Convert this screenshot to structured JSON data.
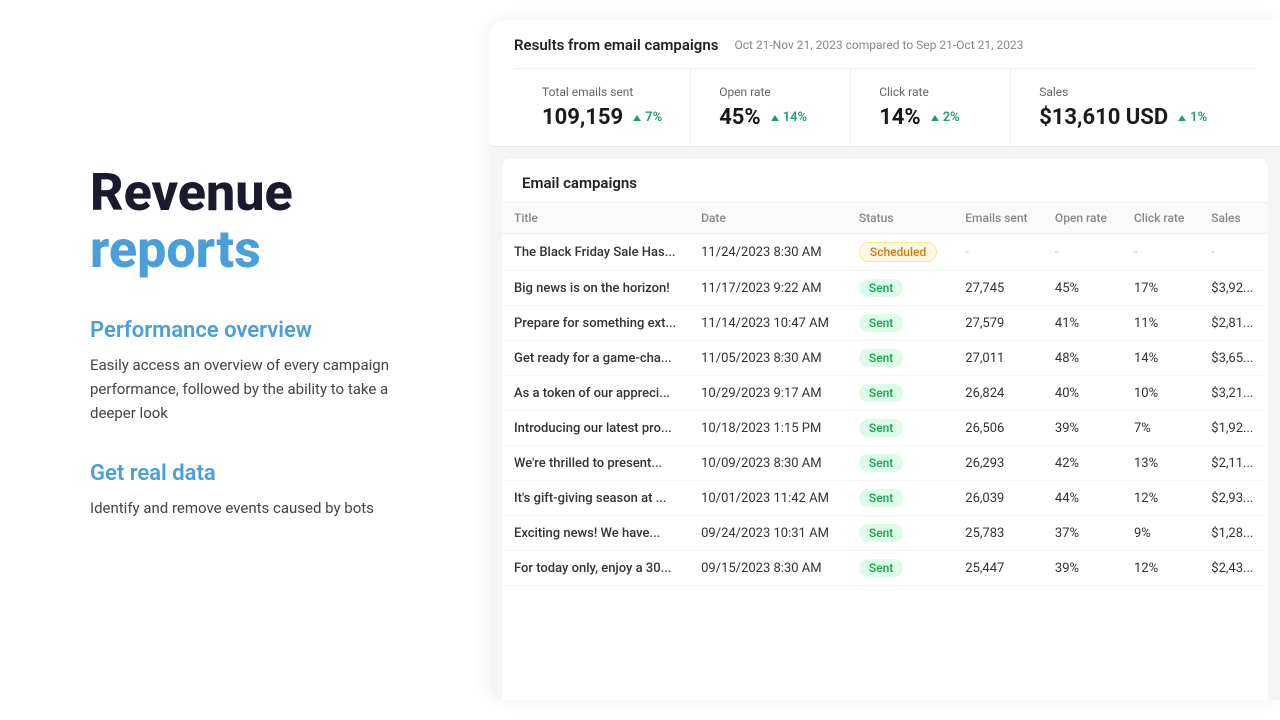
{
  "left": {
    "title_main": "Revenue",
    "title_highlight": "reports",
    "sections": [
      {
        "heading": "Performance overview",
        "desc": "Easily access an overview of every campaign performance, followed by the ability to take a deeper look"
      },
      {
        "heading": "Get real data",
        "desc": "Identify and remove events caused by bots"
      }
    ]
  },
  "stats": {
    "title": "Results from email campaigns",
    "date_range": "Oct 21-Nov 21, 2023 compared to Sep 21-Oct 21, 2023",
    "cards": [
      {
        "label": "Total emails sent",
        "value": "109,159",
        "change": "7%"
      },
      {
        "label": "Open rate",
        "value": "45%",
        "change": "14%"
      },
      {
        "label": "Click rate",
        "value": "14%",
        "change": "2%"
      },
      {
        "label": "Sales",
        "value": "$13,610 USD",
        "change": "1%"
      }
    ]
  },
  "table": {
    "title": "Email campaigns",
    "columns": [
      "Title",
      "Date",
      "Status",
      "Emails sent",
      "Open rate",
      "Click rate",
      "Sales"
    ],
    "rows": [
      {
        "title": "The Black Friday Sale Has...",
        "date": "11/24/2023 8:30 AM",
        "status": "Scheduled",
        "emails_sent": "-",
        "open_rate": "-",
        "click_rate": "-",
        "sales": "-"
      },
      {
        "title": "Big news is on the horizon!",
        "date": "11/17/2023 9:22 AM",
        "status": "Sent",
        "emails_sent": "27,745",
        "open_rate": "45%",
        "click_rate": "17%",
        "sales": "$3,92..."
      },
      {
        "title": "Prepare for something ext...",
        "date": "11/14/2023 10:47 AM",
        "status": "Sent",
        "emails_sent": "27,579",
        "open_rate": "41%",
        "click_rate": "11%",
        "sales": "$2,81..."
      },
      {
        "title": "Get ready for a game-cha...",
        "date": "11/05/2023 8:30 AM",
        "status": "Sent",
        "emails_sent": "27,011",
        "open_rate": "48%",
        "click_rate": "14%",
        "sales": "$3,65..."
      },
      {
        "title": "As a token of our appreci...",
        "date": "10/29/2023 9:17 AM",
        "status": "Sent",
        "emails_sent": "26,824",
        "open_rate": "40%",
        "click_rate": "10%",
        "sales": "$3,21..."
      },
      {
        "title": "Introducing our latest pro...",
        "date": "10/18/2023 1:15 PM",
        "status": "Sent",
        "emails_sent": "26,506",
        "open_rate": "39%",
        "click_rate": "7%",
        "sales": "$1,92..."
      },
      {
        "title": "We're thrilled to present...",
        "date": "10/09/2023 8:30 AM",
        "status": "Sent",
        "emails_sent": "26,293",
        "open_rate": "42%",
        "click_rate": "13%",
        "sales": "$2,11..."
      },
      {
        "title": "It's gift-giving season at ...",
        "date": "10/01/2023 11:42 AM",
        "status": "Sent",
        "emails_sent": "26,039",
        "open_rate": "44%",
        "click_rate": "12%",
        "sales": "$2,93..."
      },
      {
        "title": "Exciting news! We have...",
        "date": "09/24/2023 10:31 AM",
        "status": "Sent",
        "emails_sent": "25,783",
        "open_rate": "37%",
        "click_rate": "9%",
        "sales": "$1,28..."
      },
      {
        "title": "For today only, enjoy a 30...",
        "date": "09/15/2023 8:30 AM",
        "status": "Sent",
        "emails_sent": "25,447",
        "open_rate": "39%",
        "click_rate": "12%",
        "sales": "$2,43..."
      }
    ]
  }
}
